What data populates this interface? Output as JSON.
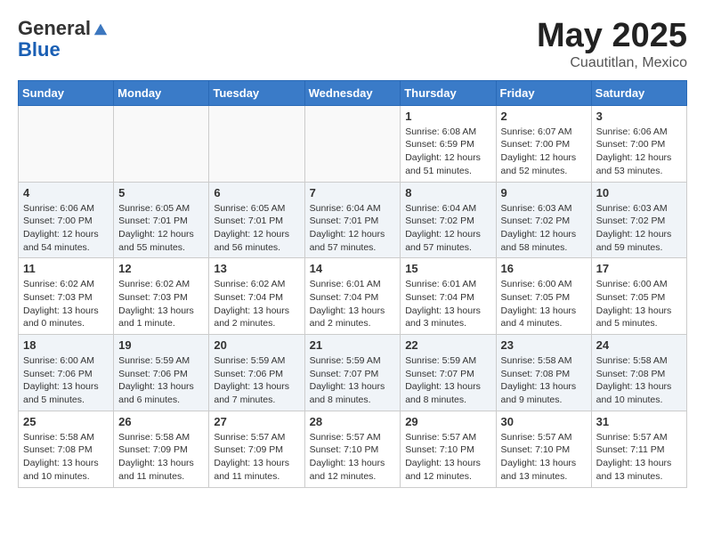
{
  "header": {
    "logo_general": "General",
    "logo_blue": "Blue",
    "month_title": "May 2025",
    "location": "Cuautitlan, Mexico"
  },
  "days_of_week": [
    "Sunday",
    "Monday",
    "Tuesday",
    "Wednesday",
    "Thursday",
    "Friday",
    "Saturday"
  ],
  "weeks": [
    [
      {
        "day": "",
        "info": ""
      },
      {
        "day": "",
        "info": ""
      },
      {
        "day": "",
        "info": ""
      },
      {
        "day": "",
        "info": ""
      },
      {
        "day": "1",
        "info": "Sunrise: 6:08 AM\nSunset: 6:59 PM\nDaylight: 12 hours\nand 51 minutes."
      },
      {
        "day": "2",
        "info": "Sunrise: 6:07 AM\nSunset: 7:00 PM\nDaylight: 12 hours\nand 52 minutes."
      },
      {
        "day": "3",
        "info": "Sunrise: 6:06 AM\nSunset: 7:00 PM\nDaylight: 12 hours\nand 53 minutes."
      }
    ],
    [
      {
        "day": "4",
        "info": "Sunrise: 6:06 AM\nSunset: 7:00 PM\nDaylight: 12 hours\nand 54 minutes."
      },
      {
        "day": "5",
        "info": "Sunrise: 6:05 AM\nSunset: 7:01 PM\nDaylight: 12 hours\nand 55 minutes."
      },
      {
        "day": "6",
        "info": "Sunrise: 6:05 AM\nSunset: 7:01 PM\nDaylight: 12 hours\nand 56 minutes."
      },
      {
        "day": "7",
        "info": "Sunrise: 6:04 AM\nSunset: 7:01 PM\nDaylight: 12 hours\nand 57 minutes."
      },
      {
        "day": "8",
        "info": "Sunrise: 6:04 AM\nSunset: 7:02 PM\nDaylight: 12 hours\nand 57 minutes."
      },
      {
        "day": "9",
        "info": "Sunrise: 6:03 AM\nSunset: 7:02 PM\nDaylight: 12 hours\nand 58 minutes."
      },
      {
        "day": "10",
        "info": "Sunrise: 6:03 AM\nSunset: 7:02 PM\nDaylight: 12 hours\nand 59 minutes."
      }
    ],
    [
      {
        "day": "11",
        "info": "Sunrise: 6:02 AM\nSunset: 7:03 PM\nDaylight: 13 hours\nand 0 minutes."
      },
      {
        "day": "12",
        "info": "Sunrise: 6:02 AM\nSunset: 7:03 PM\nDaylight: 13 hours\nand 1 minute."
      },
      {
        "day": "13",
        "info": "Sunrise: 6:02 AM\nSunset: 7:04 PM\nDaylight: 13 hours\nand 2 minutes."
      },
      {
        "day": "14",
        "info": "Sunrise: 6:01 AM\nSunset: 7:04 PM\nDaylight: 13 hours\nand 2 minutes."
      },
      {
        "day": "15",
        "info": "Sunrise: 6:01 AM\nSunset: 7:04 PM\nDaylight: 13 hours\nand 3 minutes."
      },
      {
        "day": "16",
        "info": "Sunrise: 6:00 AM\nSunset: 7:05 PM\nDaylight: 13 hours\nand 4 minutes."
      },
      {
        "day": "17",
        "info": "Sunrise: 6:00 AM\nSunset: 7:05 PM\nDaylight: 13 hours\nand 5 minutes."
      }
    ],
    [
      {
        "day": "18",
        "info": "Sunrise: 6:00 AM\nSunset: 7:06 PM\nDaylight: 13 hours\nand 5 minutes."
      },
      {
        "day": "19",
        "info": "Sunrise: 5:59 AM\nSunset: 7:06 PM\nDaylight: 13 hours\nand 6 minutes."
      },
      {
        "day": "20",
        "info": "Sunrise: 5:59 AM\nSunset: 7:06 PM\nDaylight: 13 hours\nand 7 minutes."
      },
      {
        "day": "21",
        "info": "Sunrise: 5:59 AM\nSunset: 7:07 PM\nDaylight: 13 hours\nand 8 minutes."
      },
      {
        "day": "22",
        "info": "Sunrise: 5:59 AM\nSunset: 7:07 PM\nDaylight: 13 hours\nand 8 minutes."
      },
      {
        "day": "23",
        "info": "Sunrise: 5:58 AM\nSunset: 7:08 PM\nDaylight: 13 hours\nand 9 minutes."
      },
      {
        "day": "24",
        "info": "Sunrise: 5:58 AM\nSunset: 7:08 PM\nDaylight: 13 hours\nand 10 minutes."
      }
    ],
    [
      {
        "day": "25",
        "info": "Sunrise: 5:58 AM\nSunset: 7:08 PM\nDaylight: 13 hours\nand 10 minutes."
      },
      {
        "day": "26",
        "info": "Sunrise: 5:58 AM\nSunset: 7:09 PM\nDaylight: 13 hours\nand 11 minutes."
      },
      {
        "day": "27",
        "info": "Sunrise: 5:57 AM\nSunset: 7:09 PM\nDaylight: 13 hours\nand 11 minutes."
      },
      {
        "day": "28",
        "info": "Sunrise: 5:57 AM\nSunset: 7:10 PM\nDaylight: 13 hours\nand 12 minutes."
      },
      {
        "day": "29",
        "info": "Sunrise: 5:57 AM\nSunset: 7:10 PM\nDaylight: 13 hours\nand 12 minutes."
      },
      {
        "day": "30",
        "info": "Sunrise: 5:57 AM\nSunset: 7:10 PM\nDaylight: 13 hours\nand 13 minutes."
      },
      {
        "day": "31",
        "info": "Sunrise: 5:57 AM\nSunset: 7:11 PM\nDaylight: 13 hours\nand 13 minutes."
      }
    ]
  ]
}
